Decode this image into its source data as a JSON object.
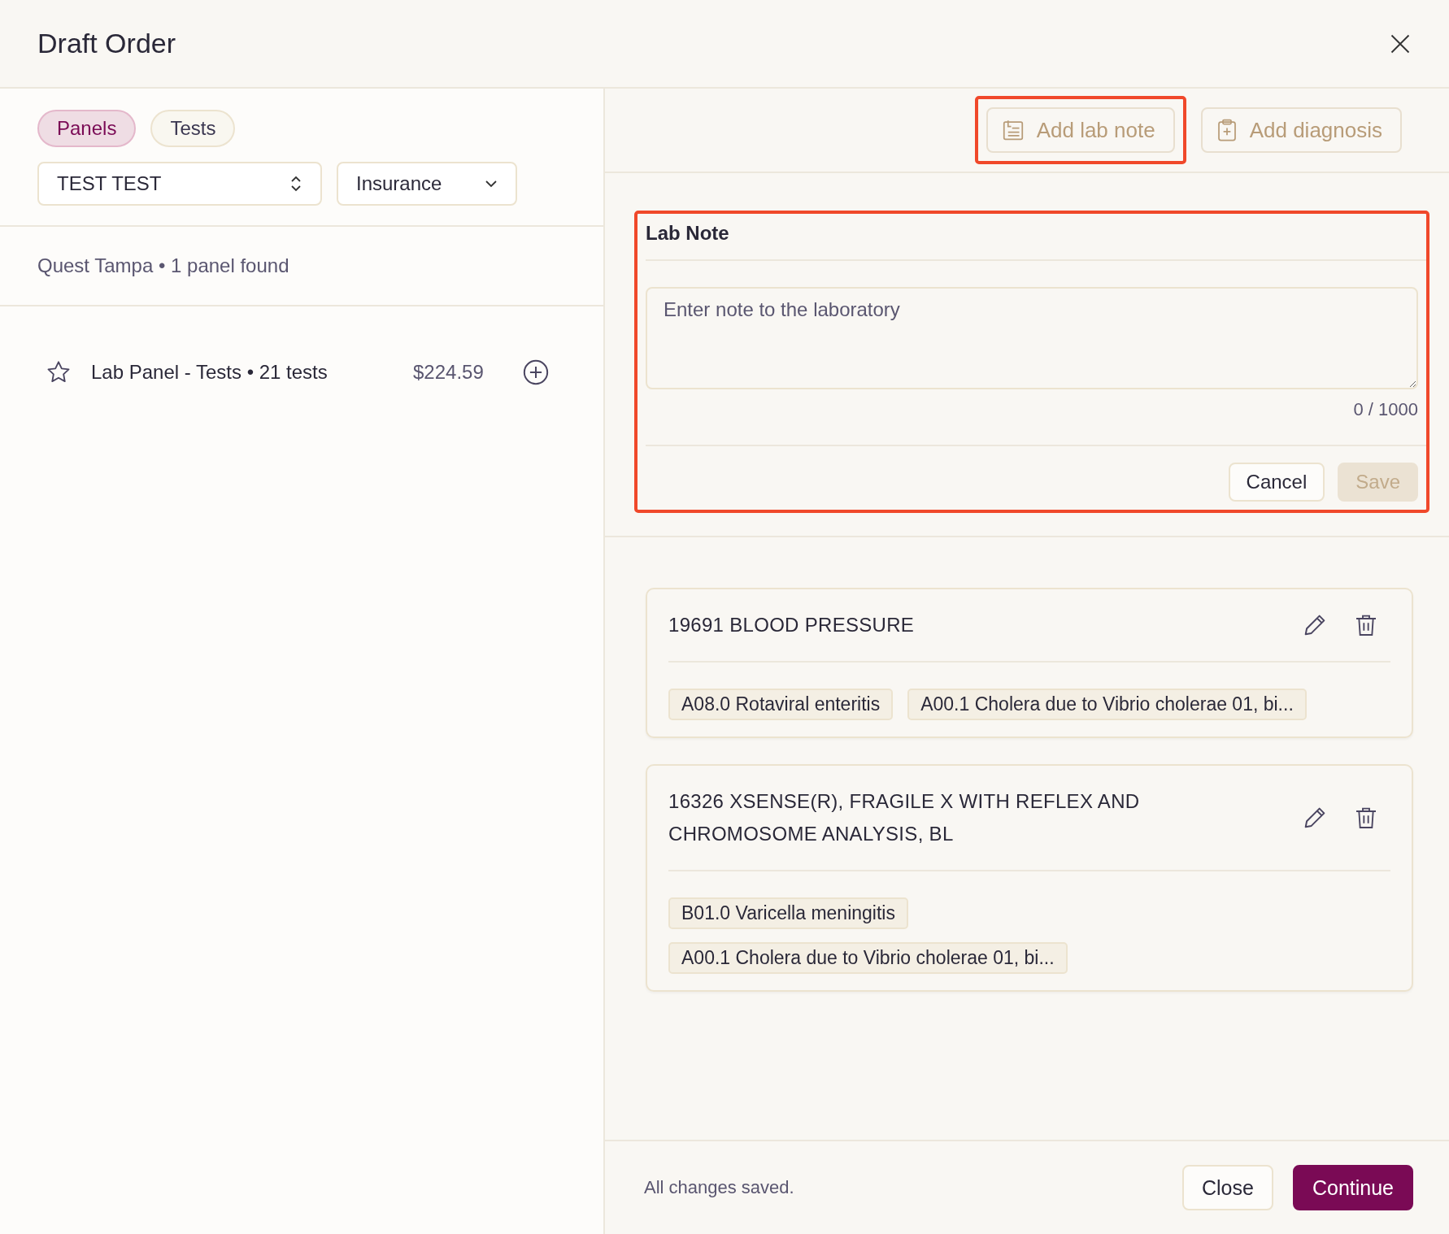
{
  "window": {
    "title": "Draft Order"
  },
  "tabs": [
    {
      "label": "Panels",
      "selected": true
    },
    {
      "label": "Tests",
      "selected": false
    }
  ],
  "selects": [
    {
      "kind": "stepper",
      "value": "TEST TEST"
    },
    {
      "kind": "dropdown",
      "value": "Insurance"
    }
  ],
  "results_summary": "Quest Tampa • 1 panel found",
  "panels": [
    {
      "name": "Lab Panel - Tests • 21 tests",
      "price": "$224.59",
      "favorite": false
    }
  ],
  "toolbar": [
    {
      "kind": "note",
      "label": "Add lab note",
      "highlighted": true
    },
    {
      "kind": "diagnosis",
      "label": "Add diagnosis",
      "highlighted": false
    }
  ],
  "lab_note": {
    "title": "Lab Note",
    "placeholder": "Enter note to the laboratory",
    "counter": "0 / 1000",
    "highlighted": true,
    "buttons": [
      {
        "label": "Cancel",
        "disabled": false
      },
      {
        "label": "Save",
        "disabled": true
      }
    ]
  },
  "tests": [
    {
      "title": "19691 BLOOD PRESSURE",
      "diagnosis_rows": [
        [
          "A08.0 Rotaviral enteritis",
          "A00.1 Cholera due to Vibrio cholerae 01, bi..."
        ]
      ]
    },
    {
      "title": "16326 XSENSE(R), FRAGILE X WITH REFLEX AND CHROMOSOME ANALYSIS, BL",
      "diagnosis_rows": [
        [
          "B01.0 Varicella meningitis"
        ],
        [
          "A00.1 Cholera due to Vibrio cholerae 01, bi..."
        ]
      ]
    }
  ],
  "footer": {
    "status": "All changes saved.",
    "buttons": [
      {
        "kind": "secondary",
        "label": "Close"
      },
      {
        "kind": "primary",
        "label": "Continue"
      }
    ]
  }
}
